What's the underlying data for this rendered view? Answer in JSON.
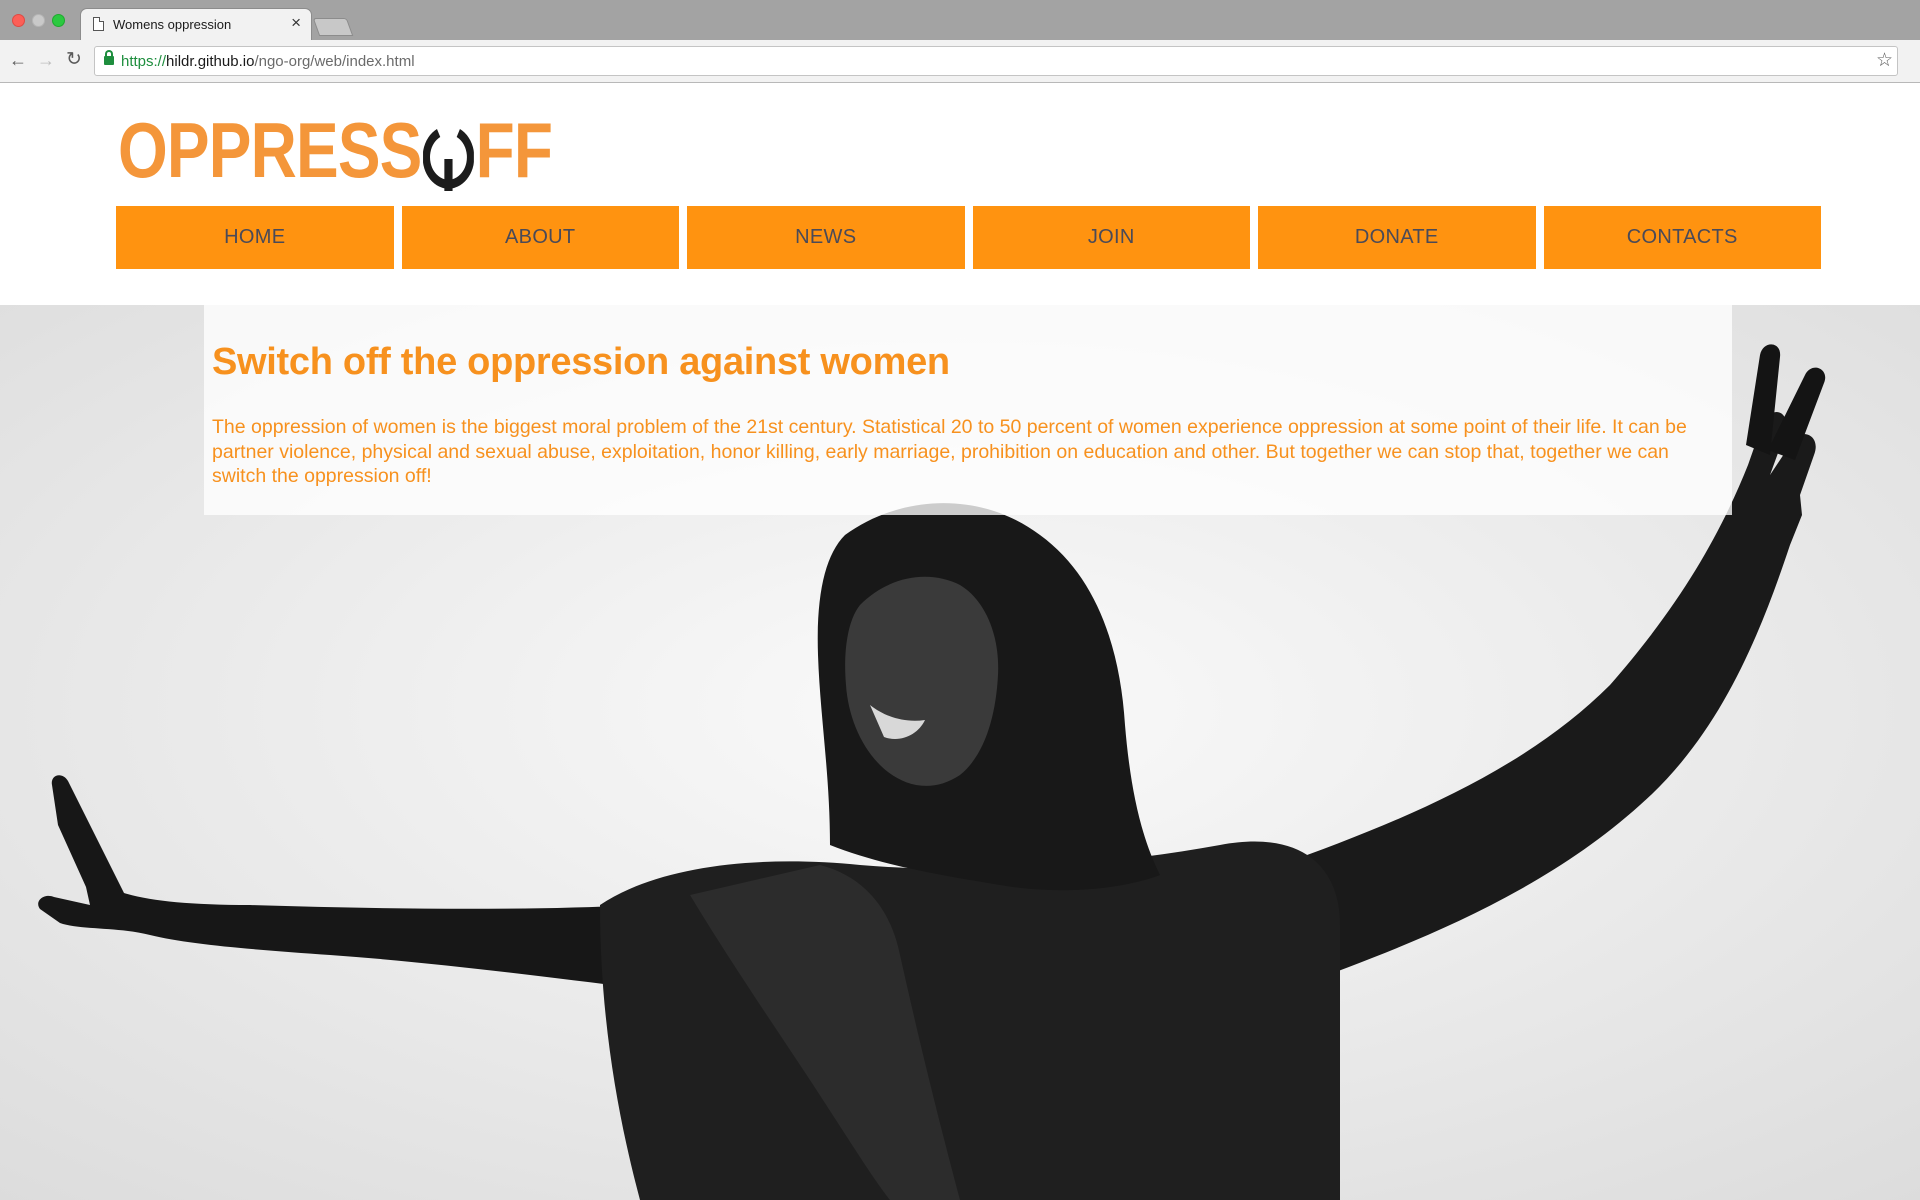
{
  "browser": {
    "tab_title": "Womens oppression",
    "tab_close_glyph": "×",
    "url_scheme": "https://",
    "url_host": "hildr.github.io",
    "url_path": "/ngo-org/web/index.html",
    "back_glyph": "←",
    "forward_glyph": "→",
    "reload_glyph": "↻",
    "star_glyph": "☆"
  },
  "logo": {
    "text_left": "OPPRESS",
    "text_right": "FF",
    "icon": "power-icon",
    "color": "#f4963a"
  },
  "nav": {
    "items": [
      {
        "label": "HOME"
      },
      {
        "label": "ABOUT"
      },
      {
        "label": "NEWS"
      },
      {
        "label": "JOIN"
      },
      {
        "label": "DONATE"
      },
      {
        "label": "CONTACTS"
      }
    ],
    "background_color": "#ff9310",
    "text_color": "#4a4a58"
  },
  "hero": {
    "headline": "Switch off the oppression against women",
    "body": "The oppression of women is the biggest moral problem of the 21st century. Statistical 20 to 50 percent of women experience oppression at some point of their life. It can be partner violence, physical and sexual abuse, exploitation, honor killing, early marriage, prohibition on education and other. But together we can stop that, together we can switch the oppression off!",
    "text_color": "#f7911e",
    "image": "black-and-white photo of a woman in a headscarf with arms outstretched making peace signs"
  }
}
